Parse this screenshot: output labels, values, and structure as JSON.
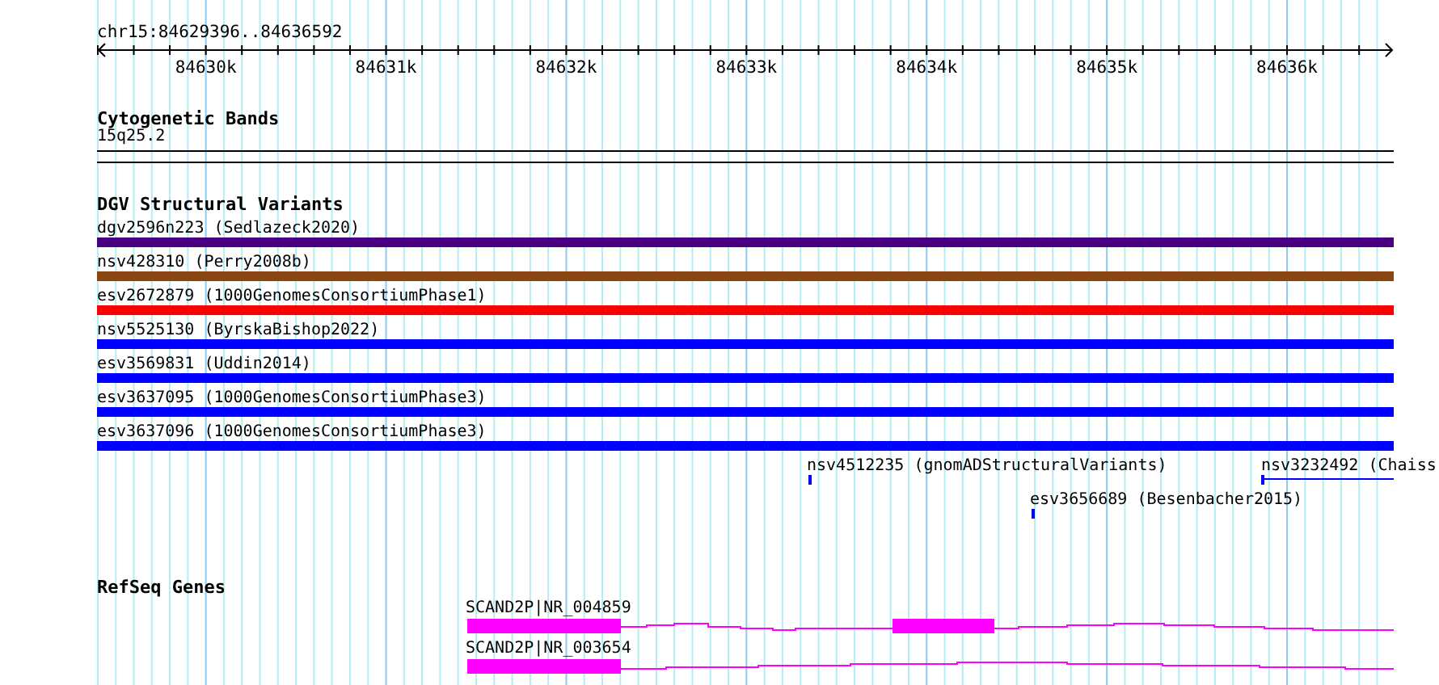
{
  "ruler": {
    "location": "chr15:84629396..84636592",
    "tick_labels": [
      "84630k",
      "84631k",
      "84632k",
      "84633k",
      "84634k",
      "84635k",
      "84636k"
    ]
  },
  "cytogenetic_bands": {
    "title": "Cytogenetic Bands",
    "band": "15q25.2"
  },
  "dgv": {
    "title": "DGV Structural Variants",
    "variants": [
      {
        "label": "dgv2596n223 (Sedlazeck2020)",
        "color": "#4b0082",
        "kind": "full"
      },
      {
        "label": "nsv428310 (Perry2008b)",
        "color": "#8b4513",
        "kind": "full"
      },
      {
        "label": "esv2672879 (1000GenomesConsortiumPhase1)",
        "color": "#ff0000",
        "kind": "full"
      },
      {
        "label": "nsv5525130 (ByrskaBishop2022)",
        "color": "#0000ff",
        "kind": "full"
      },
      {
        "label": "esv3569831 (Uddin2014)",
        "color": "#0000ff",
        "kind": "full"
      },
      {
        "label": "esv3637095 (1000GenomesConsortiumPhase3)",
        "color": "#0000ff",
        "kind": "full"
      },
      {
        "label": "esv3637096 (1000GenomesConsortiumPhase3)",
        "color": "#0000ff",
        "kind": "full"
      },
      {
        "label": "nsv4512235 (gnomADStructuralVariants)",
        "color": "#0000ff",
        "kind": "point"
      },
      {
        "label": "nsv3232492 (Chaiss",
        "color": "#0000ff",
        "kind": "span"
      },
      {
        "label": "esv3656689 (Besenbacher2015)",
        "color": "#0000ff",
        "kind": "point"
      }
    ]
  },
  "refseq": {
    "title": "RefSeq Genes",
    "genes": [
      {
        "label": "SCAND2P|NR_004859"
      },
      {
        "label": "SCAND2P|NR_003654"
      }
    ]
  }
}
